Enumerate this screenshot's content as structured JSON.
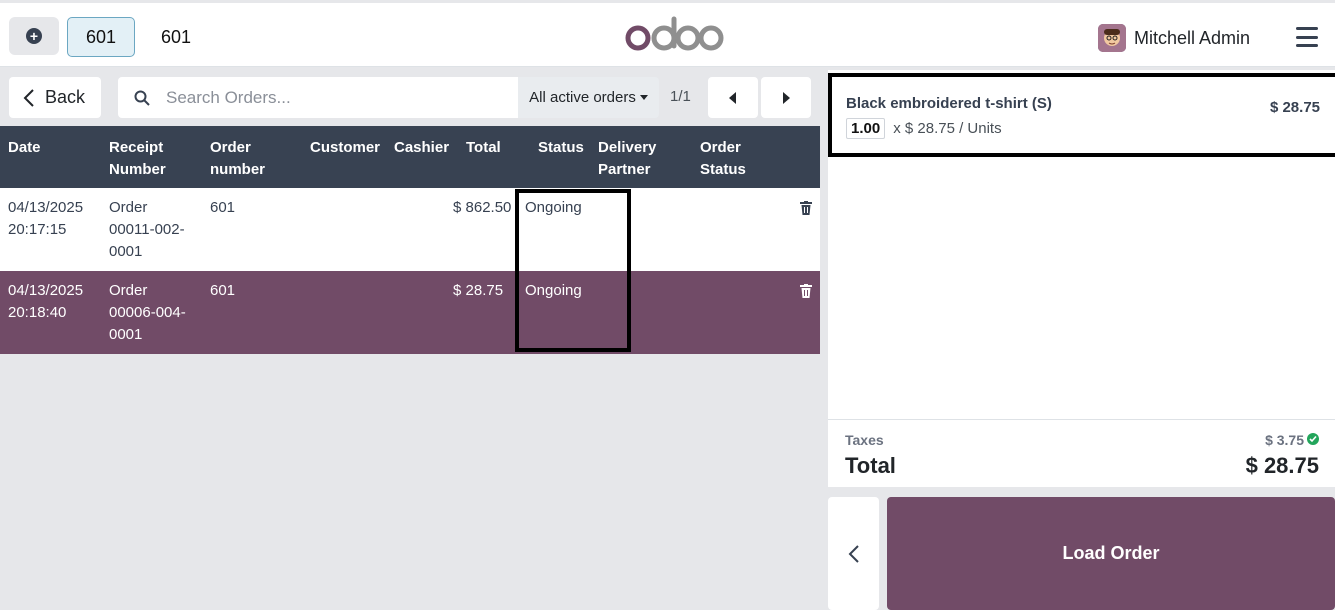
{
  "topbar": {
    "tabs": [
      {
        "label": "601",
        "active": true
      },
      {
        "label": "601",
        "active": false
      }
    ],
    "logo_text": "odoo",
    "user_name": "Mitchell Admin",
    "icons": [
      "plus-circle-icon",
      "avatar",
      "hamburger-menu-icon"
    ]
  },
  "toolbar": {
    "back_label": "Back",
    "search_placeholder": "Search Orders...",
    "filter_label": "All active orders",
    "pager": "1/1"
  },
  "table": {
    "headers": [
      "Date",
      "Receipt Number",
      "Order number",
      "Customer",
      "Cashier",
      "Total",
      "Status",
      "Delivery Partner",
      "Order Status"
    ],
    "rows": [
      {
        "date": "04/13/2025",
        "time": "20:17:15",
        "receipt_1": "Order",
        "receipt_2": "00011-002-",
        "receipt_3": "0001",
        "order_number": "601",
        "customer": "",
        "cashier": "",
        "total": "$ 862.50",
        "status": "Ongoing",
        "selected": false
      },
      {
        "date": "04/13/2025",
        "time": "20:18:40",
        "receipt_1": "Order",
        "receipt_2": "00006-004-",
        "receipt_3": "0001",
        "order_number": "601",
        "customer": "",
        "cashier": "",
        "total": "$ 28.75",
        "status": "Ongoing",
        "selected": true
      }
    ]
  },
  "order_detail": {
    "line": {
      "product": "Black embroidered t-shirt (S)",
      "price": "$ 28.75",
      "qty": "1.00",
      "unit_text": "x $ 28.75 / Units"
    },
    "taxes_label": "Taxes",
    "taxes_value": "$ 3.75",
    "total_label": "Total",
    "total_value": "$ 28.75",
    "load_label": "Load Order"
  },
  "colors": {
    "brand": "#714b67",
    "header_bg": "#384252",
    "tab_active_bg": "#e3f0f6"
  }
}
